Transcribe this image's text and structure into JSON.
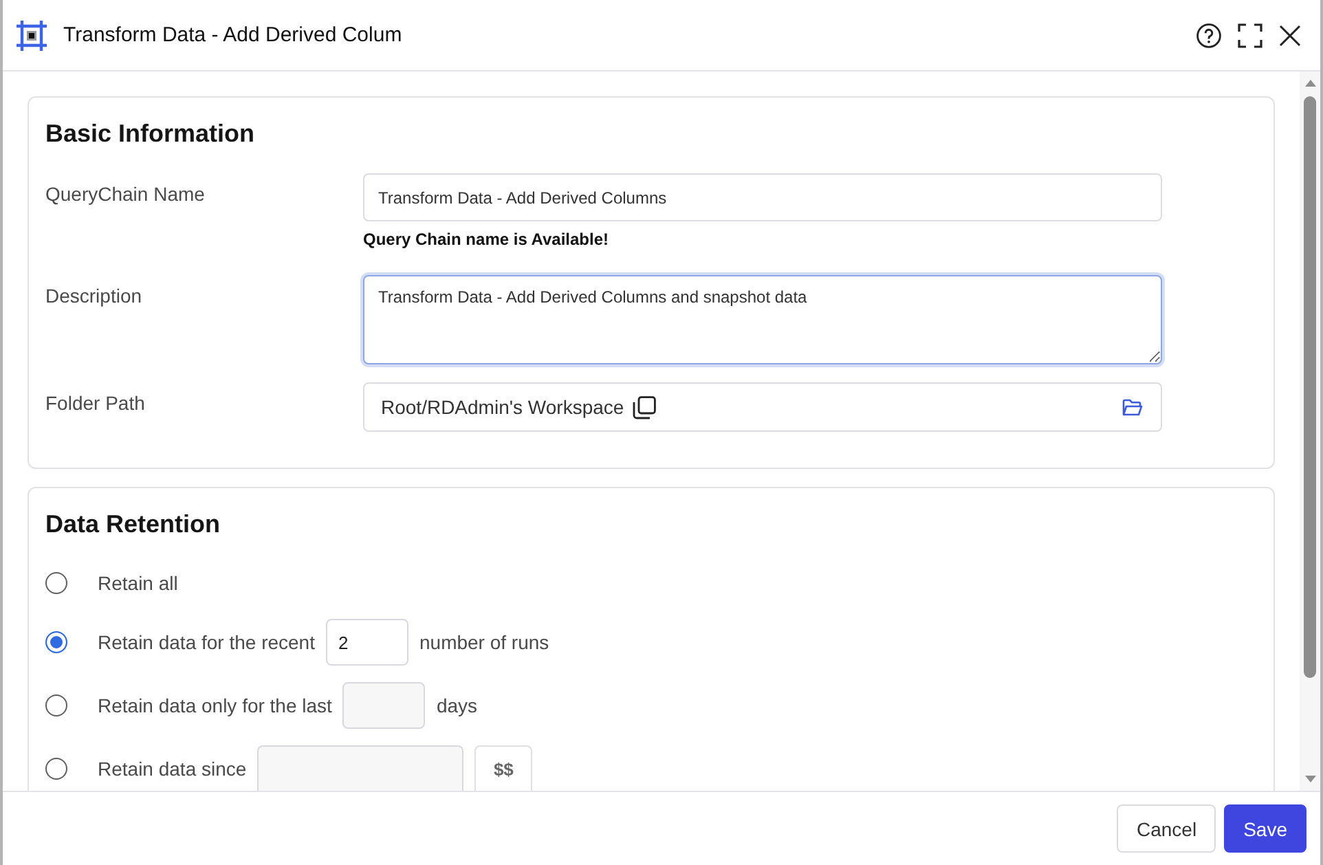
{
  "window": {
    "title": "Transform Data - Add Derived Colum"
  },
  "basic_information": {
    "title": "Basic Information",
    "name_field": {
      "label": "QueryChain Name",
      "value": "Transform Data - Add Derived Columns",
      "message": "Query Chain name is Available!"
    },
    "description_field": {
      "label": "Description",
      "value": "Transform Data - Add Derived Columns and snapshot data",
      "focused": true
    },
    "folder_field": {
      "label": "Folder Path",
      "value": "Root/RDAdmin's Workspace"
    }
  },
  "data_retention": {
    "title": "Data Retention",
    "options": [
      {
        "kind": "plain",
        "label": "Retain all",
        "selected": false
      },
      {
        "kind": "number",
        "label": "Retain data for the recent",
        "value": "2",
        "suffix": "number of runs",
        "selected": true
      },
      {
        "kind": "number",
        "label": "Retain data only for the last",
        "suffix": "days",
        "selected": false
      },
      {
        "kind": "date",
        "label": "Retain data since",
        "button": "$$",
        "selected": false
      }
    ]
  },
  "footer": {
    "buttons": [
      {
        "kind": "secondary",
        "label": "Cancel"
      },
      {
        "kind": "primary",
        "label": "Save"
      }
    ]
  }
}
